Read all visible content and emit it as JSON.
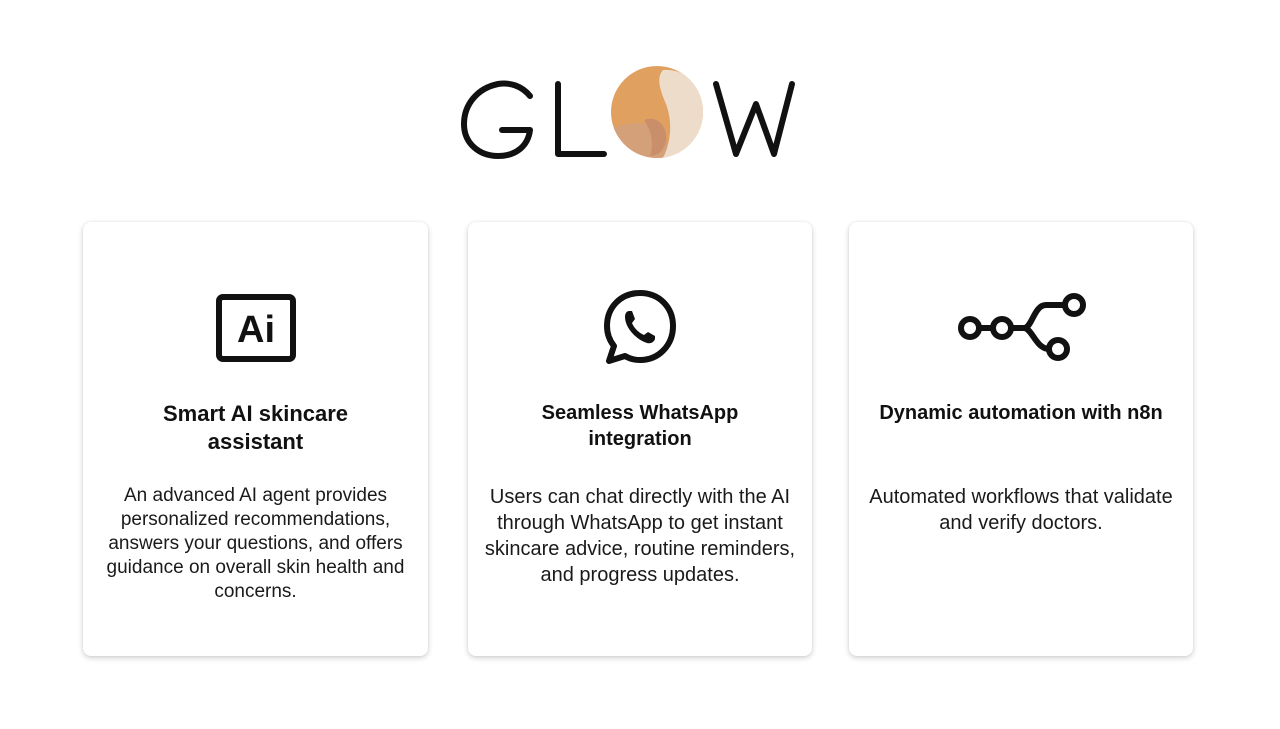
{
  "brand": {
    "logo_text": "GLOW",
    "logo_colors": {
      "ink": "#111111",
      "orb_primary": "#E0A060",
      "orb_secondary": "#C98F6A",
      "orb_light": "#EEDCCB"
    }
  },
  "features": [
    {
      "icon": "ai-chip-icon",
      "icon_text": "Ai",
      "title": "Smart AI skincare assistant",
      "description": "An advanced AI agent provides personalized recommendations, answers your questions, and offers guidance on overall skin health and concerns."
    },
    {
      "icon": "whatsapp-icon",
      "title": "Seamless WhatsApp integration",
      "description": "Users can chat directly with the AI through WhatsApp to get instant skincare advice, routine reminders, and progress updates."
    },
    {
      "icon": "n8n-workflow-icon",
      "title": "Dynamic automation with n8n",
      "description": "Automated workflows that validate and verify doctors."
    }
  ]
}
